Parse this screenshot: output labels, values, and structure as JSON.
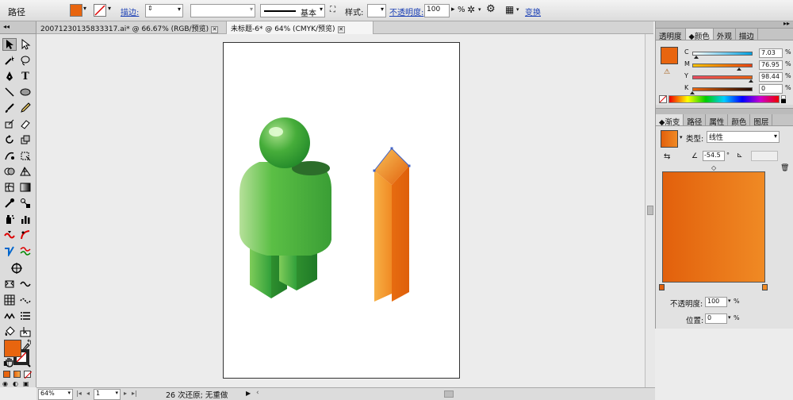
{
  "control_bar": {
    "type_label": "路径",
    "stroke_link": "描边:",
    "brush_label": "基本",
    "style_label": "样式:",
    "opacity_link": "不透明度:",
    "opacity_value": "100",
    "opacity_unit": "%",
    "transform_link": "变换",
    "fill_color": "#e8650f"
  },
  "doc_tabs": [
    {
      "label": "20071230135833317.ai* @ 66.67% (RGB/预览)"
    },
    {
      "label": "未标题-6* @ 64% (CMYK/预览)"
    }
  ],
  "color_panel": {
    "tabs": [
      "透明度",
      "颜色",
      "外观",
      "描边"
    ],
    "channels": [
      {
        "label": "C",
        "value": "7.03",
        "unit": "%",
        "fraction": 0.07
      },
      {
        "label": "M",
        "value": "76.95",
        "unit": "%",
        "fraction": 0.77
      },
      {
        "label": "Y",
        "value": "98.44",
        "unit": "%",
        "fraction": 0.98
      },
      {
        "label": "K",
        "value": "0",
        "unit": "%",
        "fraction": 0.0
      }
    ],
    "swatch": "#e8650f"
  },
  "gradient_panel": {
    "tabs": [
      "渐变",
      "路径",
      "属性",
      "颜色",
      "图层"
    ],
    "type_label": "类型:",
    "type_value": "线性",
    "angle_value": "-54.5",
    "angle_unit": "°",
    "opacity_label": "不透明度:",
    "opacity_value": "100",
    "opacity_unit": "%",
    "position_label": "位置:",
    "position_value": "0",
    "position_unit": "%",
    "start_color": "#e2600c",
    "end_color": "#f08a24"
  },
  "status_bar": {
    "zoom": "64%",
    "page": "1",
    "undo_text": "26 次还原; 无重做"
  },
  "colors": {
    "orange": "#e8650f",
    "green": "#4cae3e",
    "panel_bg": "#d6d6d6"
  }
}
